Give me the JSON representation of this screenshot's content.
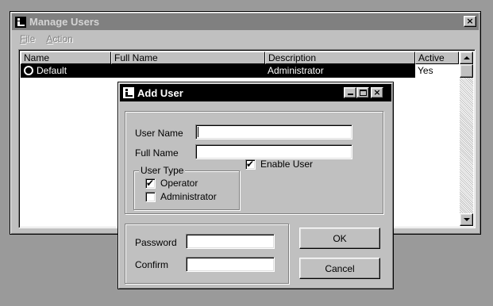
{
  "manage_users": {
    "title": "Manage Users",
    "close_glyph": "×",
    "menu": [
      {
        "label": "File",
        "accel": "F",
        "rest": "ile"
      },
      {
        "label": "Action",
        "accel": "A",
        "rest": "ction"
      }
    ],
    "list": {
      "columns": [
        "Name",
        "Full Name",
        "Description",
        "Active"
      ],
      "rows": [
        {
          "name": "Default",
          "full_name": "",
          "description": "Administrator",
          "active": "Yes",
          "icon": "user-icon"
        }
      ]
    }
  },
  "add_user": {
    "title": "Add User",
    "minimize_glyph": "_",
    "close_glyph": "×",
    "user_name_label": "User Name",
    "user_name_value": "",
    "full_name_label": "Full Name",
    "full_name_value": "",
    "user_type_label": "User Type",
    "operator_label": "Operator",
    "operator_checked": true,
    "administrator_label": "Administrator",
    "administrator_checked": false,
    "enable_user_label": "Enable User",
    "enable_user_checked": true,
    "password_label": "Password",
    "password_value": "",
    "confirm_label": "Confirm",
    "confirm_value": "",
    "ok_label": "OK",
    "cancel_label": "Cancel"
  },
  "colors": {
    "desktop": "#9a9a9a",
    "face": "#c0c0c0",
    "inactive_titlebar": "#808080",
    "active_titlebar": "#000000",
    "selection": "#000000"
  }
}
